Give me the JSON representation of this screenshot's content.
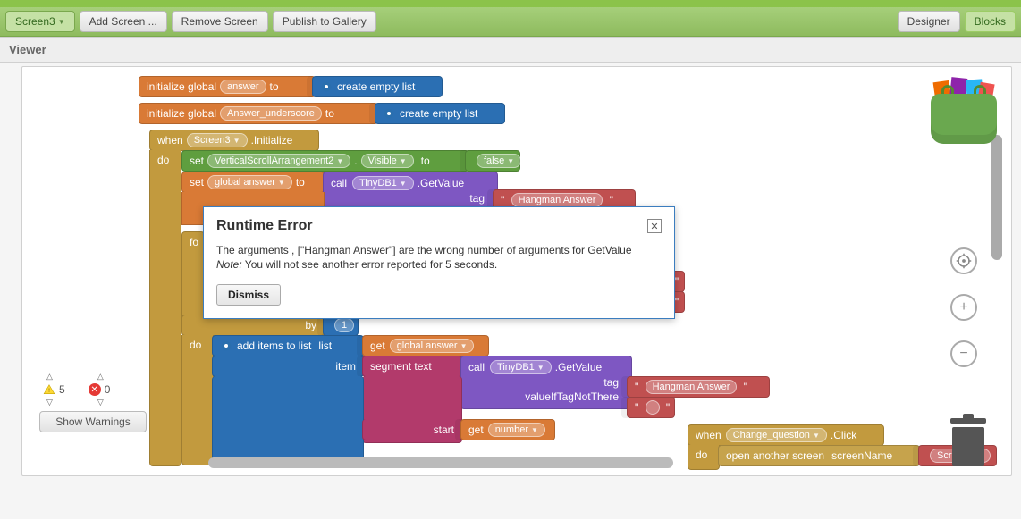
{
  "toolbar": {
    "screen_selector": "Screen3",
    "add_screen": "Add Screen ...",
    "remove_screen": "Remove Screen",
    "publish": "Publish to Gallery",
    "designer": "Designer",
    "blocks": "Blocks"
  },
  "viewer_label": "Viewer",
  "warnings": {
    "warn_count": "5",
    "error_count": "0",
    "show_button": "Show Warnings"
  },
  "icons": {
    "center": "center-target-icon",
    "plus": "plus-icon",
    "minus": "minus-icon",
    "trash": "trash-icon",
    "backpack": "backpack-icon"
  },
  "modal": {
    "title": "Runtime Error",
    "body_main": "The arguments , [\"Hangman Answer\"] are the wrong number of arguments for GetValue",
    "body_note_label": "Note:",
    "body_note_rest": " You will not see another error reported for 5 seconds.",
    "dismiss": "Dismiss"
  },
  "blocks": {
    "init_global": "initialize global",
    "answer_var": "answer",
    "answer_underscore_var": "Answer_underscore",
    "to": "to",
    "create_empty_list": "create empty list",
    "when": "when",
    "screen3": "Screen3",
    "dot_initialize": ".Initialize",
    "do": "do",
    "set": "set",
    "vsa2": "VerticalScrollArrangement2",
    "dot": ".",
    "visible": "Visible",
    "false": "false",
    "global_answer": "global answer",
    "call": "call",
    "tinydb1": "TinyDB1",
    "dot_getvalue": ".GetValue",
    "tag": "tag",
    "hangman_answer": "Hangman Answer",
    "for": "fo",
    "by": "by",
    "one": "1",
    "add_items_to_list": "add items to list",
    "list": "list",
    "get": "get",
    "item": "item",
    "segment_text": "segment  text",
    "valueIfTagNotThere": "valueIfTagNotThere",
    "start": "start",
    "number": "number",
    "change_question": "Change_question",
    "dot_click": ".Click",
    "open_another_screen": "open another screen",
    "screenName": "screenName",
    "screen2": "Screen2"
  }
}
